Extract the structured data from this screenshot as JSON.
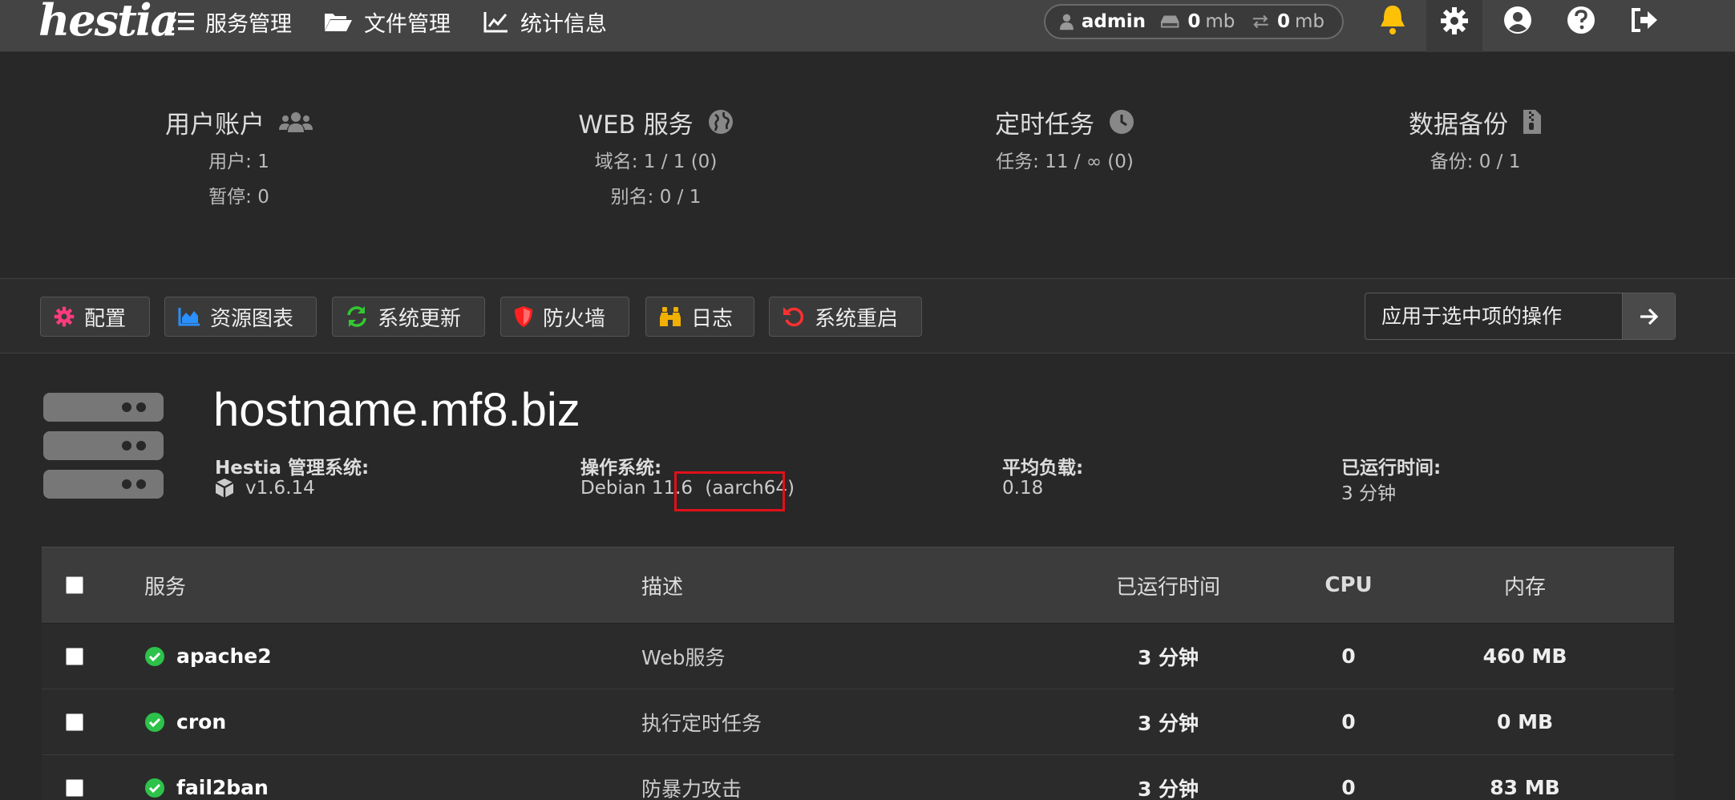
{
  "brand": {
    "logo_text": "hestia"
  },
  "nav": [
    {
      "label": "服务管理",
      "icon": "list-check-icon"
    },
    {
      "label": "文件管理",
      "icon": "folder-open-icon"
    },
    {
      "label": "统计信息",
      "icon": "chart-line-icon"
    }
  ],
  "userbar": {
    "user": "admin",
    "disk_value": "0",
    "disk_unit": "mb",
    "bw_value": "0",
    "bw_unit": "mb"
  },
  "top_icons": [
    "bell-icon",
    "gear-icon",
    "user-circle-icon",
    "question-circle-icon",
    "logout-icon"
  ],
  "summary": {
    "users": {
      "title": "用户账户",
      "line1": "用户: 1",
      "line2": "暂停: 0"
    },
    "web": {
      "title": "WEB 服务",
      "line1": "域名: 1 / 1 (0)",
      "line2": "别名: 0 / 1"
    },
    "cron": {
      "title": "定时任务",
      "line1": "任务: 11 / ∞ (0)"
    },
    "backup": {
      "title": "数据备份",
      "line1": "备份: 0 / 1"
    }
  },
  "toolbar": {
    "buttons": [
      {
        "label": "配置",
        "icon": "cog-icon",
        "color": "#ff3b7f"
      },
      {
        "label": "资源图表",
        "icon": "chart-area-icon",
        "color": "#2a90ff"
      },
      {
        "label": "系统更新",
        "icon": "refresh-icon",
        "color": "#32c832"
      },
      {
        "label": "防火墙",
        "icon": "shield-icon",
        "color": "#ff2020"
      },
      {
        "label": "日志",
        "icon": "binoculars-icon",
        "color": "#f0b000"
      },
      {
        "label": "系统重启",
        "icon": "undo-icon",
        "color": "#ff3030"
      }
    ],
    "apply_label": "应用于选中项的操作"
  },
  "host": {
    "hostname": "hostname.mf8.biz",
    "hestia_label": "Hestia 管理系统:",
    "hestia_value": "v1.6.14",
    "os_label": "操作系统:",
    "os_value": "Debian 11.6",
    "os_arch": "(aarch64)",
    "load_label": "平均负载:",
    "load_value": "0.18",
    "uptime_label": "已运行时间:",
    "uptime_value": "3 分钟"
  },
  "table": {
    "headers": {
      "service": "服务",
      "desc": "描述",
      "uptime": "已运行时间",
      "cpu": "CPU",
      "mem": "内存"
    },
    "rows": [
      {
        "name": "apache2",
        "desc": "Web服务",
        "uptime": "3 分钟",
        "cpu": "0",
        "mem": "460 MB"
      },
      {
        "name": "cron",
        "desc": "执行定时任务",
        "uptime": "3 分钟",
        "cpu": "0",
        "mem": "0 MB"
      },
      {
        "name": "fail2ban",
        "desc": "防暴力攻击",
        "uptime": "3 分钟",
        "cpu": "0",
        "mem": "83 MB"
      }
    ]
  },
  "colors": {
    "accent_bell": "#ffc107",
    "status_ok": "#2dc24a",
    "highlight": "#e0101a"
  }
}
